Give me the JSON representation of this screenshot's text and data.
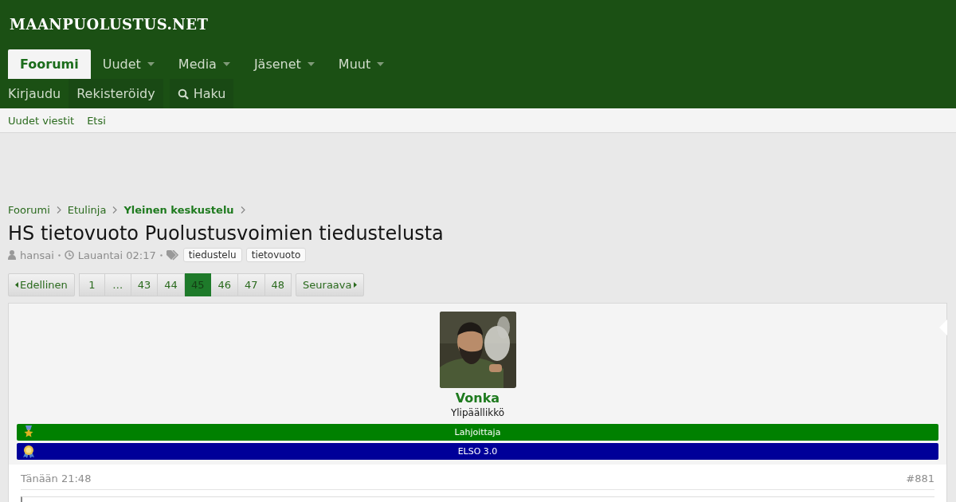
{
  "logo": "MAANPUOLUSTUS.NET",
  "nav": [
    {
      "label": "Foorumi",
      "selected": true,
      "dropdown": false
    },
    {
      "label": "Uudet",
      "selected": false,
      "dropdown": true
    },
    {
      "label": "Media",
      "selected": false,
      "dropdown": true
    },
    {
      "label": "Jäsenet",
      "selected": false,
      "dropdown": true
    },
    {
      "label": "Muut",
      "selected": false,
      "dropdown": true
    }
  ],
  "account": [
    {
      "label": "Kirjaudu",
      "kind": "plain"
    },
    {
      "label": "Rekisteröidy",
      "kind": "box"
    },
    {
      "label": "Haku",
      "kind": "search"
    }
  ],
  "subnav": [
    "Uudet viestit",
    "Etsi"
  ],
  "breadcrumbs": [
    {
      "label": "Foorumi",
      "current": false
    },
    {
      "label": "Etulinja",
      "current": false
    },
    {
      "label": "Yleinen keskustelu",
      "current": true
    }
  ],
  "thread": {
    "title": "HS tietovuoto Puolustusvoimien tiedustelusta",
    "author": "hansai",
    "date": "Lauantai 02:17",
    "tags": [
      "tiedustelu",
      "tietovuoto"
    ]
  },
  "pagination": {
    "prev": "Edellinen",
    "next": "Seuraava",
    "pages": [
      {
        "label": "1",
        "selected": false
      },
      {
        "label": "…",
        "selected": false
      },
      {
        "label": "43",
        "selected": false
      },
      {
        "label": "44",
        "selected": false
      },
      {
        "label": "45",
        "selected": true
      },
      {
        "label": "46",
        "selected": false
      },
      {
        "label": "47",
        "selected": false
      },
      {
        "label": "48",
        "selected": false
      }
    ]
  },
  "post": {
    "username": "Vonka",
    "user_title": "Ylipäällikkö",
    "banners": [
      {
        "label": "Lahjoittaja",
        "color": "#008000",
        "kind": "star"
      },
      {
        "label": "ELSO 3.0",
        "color": "#000099",
        "kind": "rosette"
      }
    ],
    "time": "Tänään 21:48",
    "number": "#881"
  }
}
